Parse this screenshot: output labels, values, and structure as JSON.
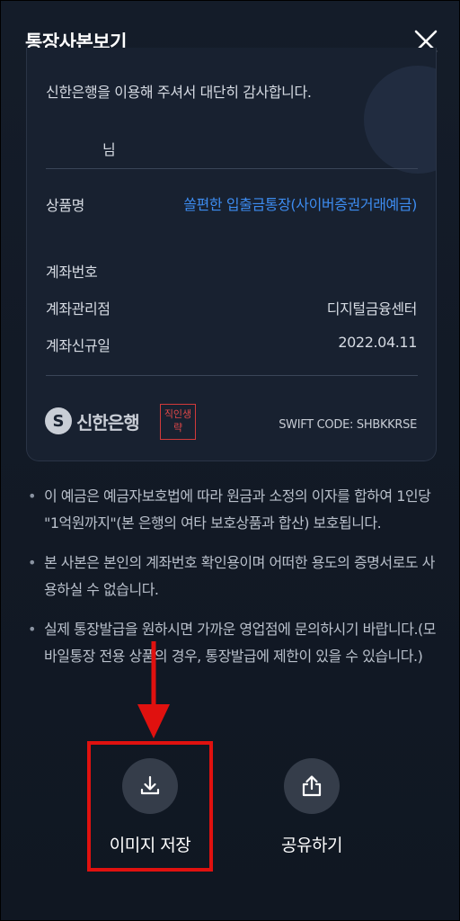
{
  "header": {
    "title": "통장사본보기",
    "close_icon": "close-icon"
  },
  "card": {
    "thanks_text": "신한은행을 이용해 주셔서 대단히 감사합니다.",
    "name_suffix": "님",
    "rows": [
      {
        "label": "상품명",
        "value": "쏠편한 입출금통장(사이버증권거래예금)"
      },
      {
        "label": "계좌번호",
        "value": ""
      },
      {
        "label": "계좌관리점",
        "value": "디지털금융센터"
      },
      {
        "label": "계좌신규일",
        "value": "2022.04.11"
      }
    ],
    "product_color": "#3d8cf0",
    "bank_name": "신한은행",
    "seal_text": "직인생략",
    "swift_code": "SWIFT CODE: SHBKKRSE"
  },
  "notices": [
    "이 예금은 예금자보호법에 따라 원금과 소정의 이자를 합하여 1인당 \"1억원까지\"(본 은행의 여타 보호상품과 합산) 보호됩니다.",
    "본 사본은 본인의 계좌번호 확인용이며 어떠한 용도의 증명서로도 사용하실 수 없습니다.",
    "실제 통장발급을 원하시면 가까운 영업점에 문의하시기 바랍니다.(모바일통장 전용 상품의 경우, 통장발급에 제한이 있을 수 있습니다.)"
  ],
  "actions": {
    "save_label": "이미지 저장",
    "share_label": "공유하기",
    "save_icon": "download-icon",
    "share_icon": "share-icon"
  },
  "annotation": {
    "highlight_color": "#e0110f"
  }
}
